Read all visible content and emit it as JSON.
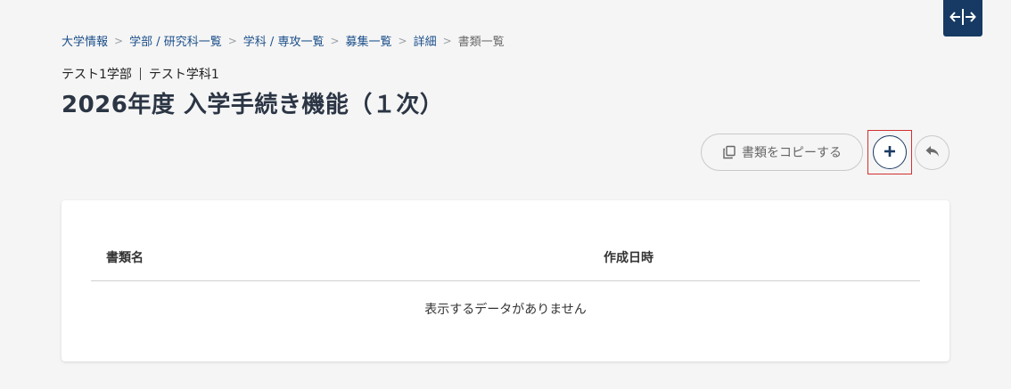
{
  "breadcrumb": {
    "items": [
      "大学情報",
      "学部 / 研究科一覧",
      "学科 / 専攻一覧",
      "募集一覧",
      "詳細"
    ],
    "separator": ">",
    "current": "書類一覧"
  },
  "subheading": {
    "faculty": "テスト1学部",
    "department": "テスト学科1"
  },
  "page_title": "2026年度 入学手続き機能（１次）",
  "toolbar": {
    "copy_label": "書類をコピーする",
    "add_icon": "plus-icon",
    "back_icon": "reply-icon"
  },
  "table": {
    "columns": [
      "書類名",
      "作成日時"
    ],
    "empty_message": "表示するデータがありません"
  },
  "colors": {
    "brand": "#173a64",
    "link": "#1b4f8a",
    "highlight": "#d32f2f"
  }
}
